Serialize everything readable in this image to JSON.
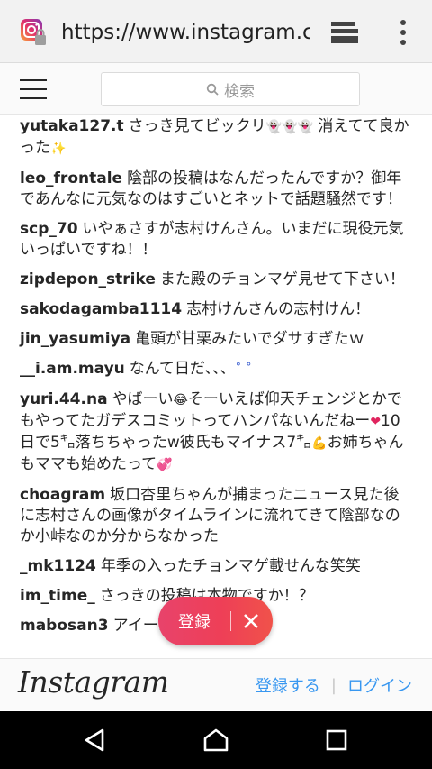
{
  "browser": {
    "url": "https://www.instagram.com",
    "site_icon": "instagram-lock-icon",
    "tabs_icon": "tabs-icon",
    "menu_icon": "menu-dots-icon"
  },
  "header": {
    "menu_icon": "hamburger-icon",
    "search_placeholder": "検索"
  },
  "comments": [
    {
      "user": "yutaka127.t",
      "text": "さっき見てビックリ",
      "emoji": "👻👻👻",
      "text2": " 消えてて良かった",
      "emoji2": "✨"
    },
    {
      "user": "leo_frontale",
      "text": "陰部の投稿はなんだったんですか？御年であんなに元気なのはすごいとネットで話題騒然です！",
      "emoji": "",
      "text2": "",
      "emoji2": ""
    },
    {
      "user": "scp_70",
      "text": "いやぁさすが志村けんさん。いまだに現役元気いっぱいですね！！",
      "emoji": "",
      "text2": "",
      "emoji2": ""
    },
    {
      "user": "zipdepon_strike",
      "text": "また殿のチョンマゲ見せて下さい！",
      "emoji": "",
      "text2": "",
      "emoji2": ""
    },
    {
      "user": "sakodagamba1114",
      "text": "志村けんさんの志村けん！",
      "emoji": "",
      "text2": "",
      "emoji2": ""
    },
    {
      "user": "jin_yasumiya",
      "text": "亀頭が甘栗みたいでダサすぎたｗ",
      "emoji": "",
      "text2": "",
      "emoji2": ""
    },
    {
      "user": "__i.am.mayu",
      "text": "なんて日だ、、、",
      "emoji": "˚ ˚",
      "text2": "",
      "emoji2": ""
    },
    {
      "user": "yuri.44.na",
      "text": "やばーい",
      "emoji": "😂",
      "text2": "そーいえば仰天チェンジとかでもやってたガデスコミットってハンパないんだねー",
      "emoji2": "❤",
      "text3": "10日で5㌔落ちちゃったw彼氏もマイナス7㌔",
      "emoji3": "💪",
      "text4": "お姉ちゃんもママも始めたって",
      "emoji4": "💞"
    },
    {
      "user": "choagram",
      "text": "坂口杏里ちゃんが捕まったニュース見た後に志村さんの画像がタイムラインに流れてきて陰部なのか小峠なのか分からなかった",
      "emoji": "",
      "text2": "",
      "emoji2": ""
    },
    {
      "user": "_mk1124",
      "text": "年季の入ったチョンマゲ載せんな笑笑",
      "emoji": "",
      "text2": "",
      "emoji2": ""
    },
    {
      "user": "im_time_",
      "text": "さっきの投稿は本物ですか！？",
      "emoji": "",
      "text2": "",
      "emoji2": ""
    },
    {
      "user": "mabosan3",
      "text": "アイーンしてたな",
      "emoji": "",
      "text2": "",
      "emoji2": ""
    }
  ],
  "floating_button": {
    "label": "登録",
    "close_icon": "close-icon"
  },
  "footer": {
    "logo": "Instagram",
    "register_link": "登録する",
    "separator": "|",
    "login_link": "ログイン"
  },
  "navbar": {
    "back_icon": "back-triangle-icon",
    "home_icon": "home-icon",
    "recents_icon": "recents-square-icon"
  },
  "colors": {
    "link": "#3897f0",
    "pill_start": "#e8436b",
    "pill_end": "#f0524a"
  }
}
